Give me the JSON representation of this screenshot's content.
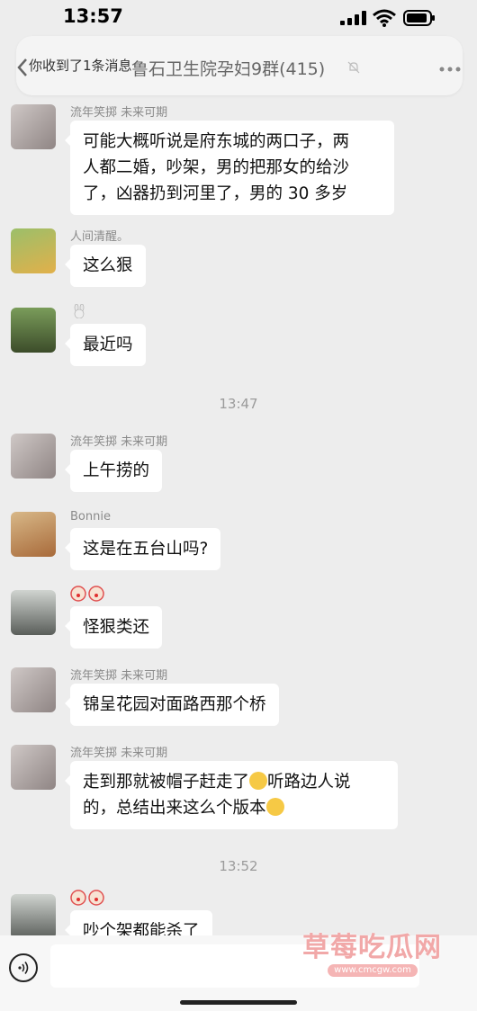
{
  "status_bar": {
    "time": "13:57"
  },
  "nav": {
    "notification": "你收到了1条消息",
    "title": "鲁石卫生院孕妇9群(415)"
  },
  "messages": [
    {
      "sender": "流年笑掷 未来可期",
      "lines": [
        "可能大概听说是府东城的两口子，两",
        "人都二婚，吵架，男的把那女的给沙",
        "了，凶器扔到河里了，男的 30 多岁"
      ]
    },
    {
      "sender": "人间清醒。",
      "lines": [
        "这么狠"
      ]
    },
    {
      "sender": "",
      "lines": [
        "最近吗"
      ]
    },
    {
      "sender": "流年笑掷 未来可期",
      "lines": [
        "上午捞的"
      ]
    },
    {
      "sender": "Bonnie",
      "lines": [
        "这是在五台山吗?"
      ]
    },
    {
      "sender": "",
      "lines": [
        "怪狠类还"
      ]
    },
    {
      "sender": "流年笑掷 未来可期",
      "lines": [
        "锦呈花园对面路西那个桥"
      ]
    },
    {
      "sender": "流年笑掷 未来可期",
      "lines": [
        "走到那就被帽子赶走了",
        "听路边人说",
        "的，总结出来这么个版本"
      ]
    },
    {
      "sender": "",
      "lines": [
        "吵个架都能杀了"
      ]
    }
  ],
  "time_dividers": [
    "13:47",
    "13:52"
  ],
  "watermark": {
    "text": "草莓吃瓜网",
    "url": "www.cmcgw.com"
  }
}
